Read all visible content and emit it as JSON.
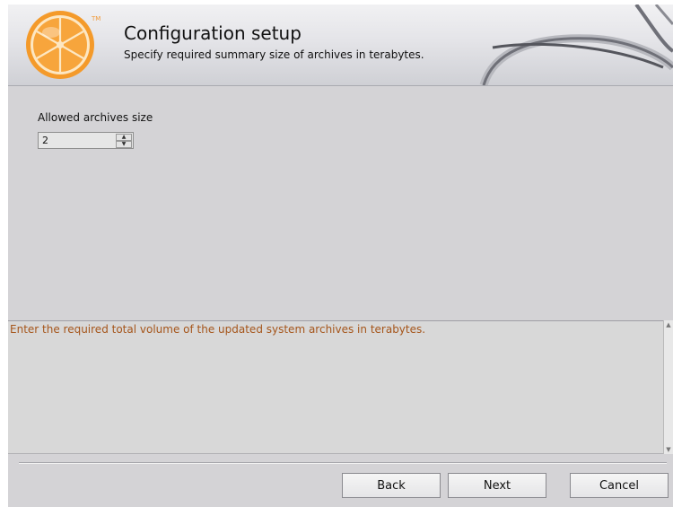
{
  "header": {
    "trademark": "TM",
    "title": "Configuration setup",
    "subtitle": "Specify required summary size of archives in terabytes."
  },
  "form": {
    "label": "Allowed archives size",
    "value": "2"
  },
  "description": {
    "text": "Enter the required total volume of the updated system archives in terabytes."
  },
  "buttons": {
    "back": "Back",
    "next": "Next",
    "cancel": "Cancel"
  },
  "colors": {
    "accent_orange": "#f08a1c",
    "description_text": "#a5551a",
    "background": "#d4d3d6"
  },
  "icons": [
    "orange-slice-logo-icon",
    "spin-up-icon",
    "spin-down-icon"
  ]
}
